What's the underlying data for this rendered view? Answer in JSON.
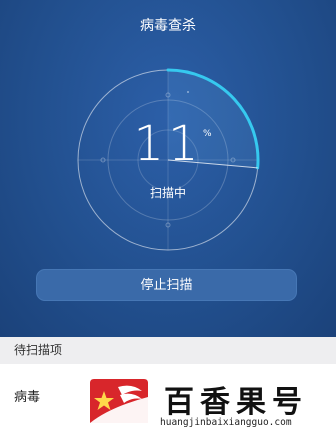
{
  "header": {
    "title": "病毒查杀"
  },
  "scan": {
    "progress_value": "11",
    "percent_sign": "%",
    "progress_fraction": 0.11,
    "status_label": "扫描中"
  },
  "actions": {
    "stop_label": "停止扫描"
  },
  "pending": {
    "header_label": "待扫描项",
    "items": [
      {
        "label": "病毒"
      }
    ]
  },
  "watermark": {
    "brand_text": "百香果号",
    "site_text": "huangjinbaixiangguo.com"
  },
  "colors": {
    "accent_arc": "#36c9ef",
    "hero_bg": "#22508f"
  }
}
